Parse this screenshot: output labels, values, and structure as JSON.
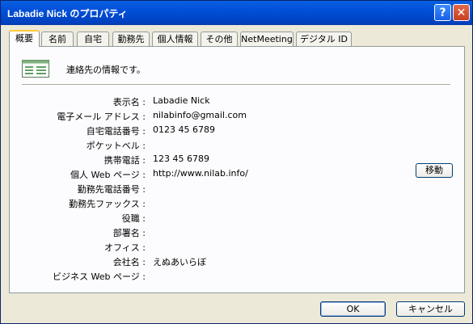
{
  "window": {
    "title": "Labadie Nick のプロパティ",
    "help_glyph": "?",
    "close_glyph": "✕"
  },
  "tabs": [
    {
      "label": "概要",
      "active": true
    },
    {
      "label": "名前"
    },
    {
      "label": "自宅"
    },
    {
      "label": "勤務先"
    },
    {
      "label": "個人情報"
    },
    {
      "label": "その他"
    },
    {
      "label": "NetMeeting"
    },
    {
      "label": "デジタル ID"
    }
  ],
  "summary": {
    "intro_text": "連絡先の情報です。",
    "fields": [
      {
        "label": "表示名 :",
        "value": "Labadie Nick"
      },
      {
        "label": "電子メール アドレス :",
        "value": "nilabinfo@gmail.com"
      },
      {
        "label": "自宅電話番号 :",
        "value": "0123 45 6789"
      },
      {
        "label": "ポケットベル :",
        "value": ""
      },
      {
        "label": "携帯電話 :",
        "value": "123 45 6789"
      },
      {
        "label": "個人 Web ページ :",
        "value": "http://www.nilab.info/"
      },
      {
        "label": "勤務先電話番号 :",
        "value": ""
      },
      {
        "label": "勤務先ファックス :",
        "value": ""
      },
      {
        "label": "役職 :",
        "value": ""
      },
      {
        "label": "部署名 :",
        "value": ""
      },
      {
        "label": "オフィス :",
        "value": ""
      },
      {
        "label": "会社名 :",
        "value": "えぬあいらぼ"
      },
      {
        "label": "ビジネス Web ページ :",
        "value": ""
      }
    ],
    "go_button": "移動"
  },
  "buttons": {
    "ok": "OK",
    "cancel": "キャンセル"
  }
}
